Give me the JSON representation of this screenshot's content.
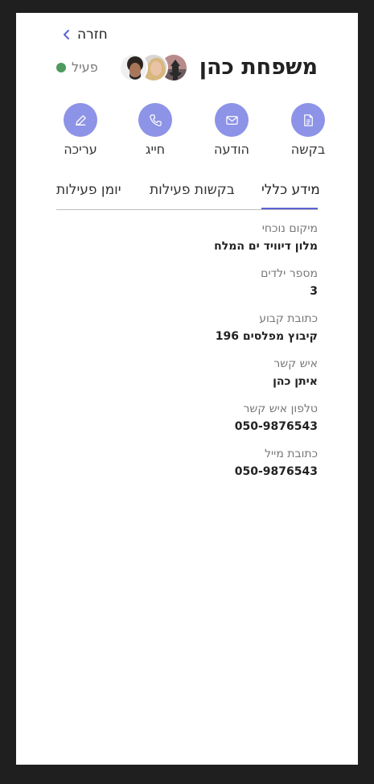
{
  "back": {
    "label": "חזרה"
  },
  "header": {
    "title": "משפחת כהן",
    "status": {
      "text": "פעיל",
      "color": "#4f9a5f"
    },
    "avatars": [
      "man-curly-hair",
      "woman-blonde",
      "pagoda-sunset"
    ]
  },
  "actions": [
    {
      "label": "בקשה",
      "icon": "document-icon"
    },
    {
      "label": "הודעה",
      "icon": "mail-icon"
    },
    {
      "label": "חייג",
      "icon": "phone-icon"
    },
    {
      "label": "עריכה",
      "icon": "pencil-icon"
    }
  ],
  "tabs": [
    {
      "label": "מידע כללי",
      "active": true
    },
    {
      "label": "בקשות פעילות",
      "active": false
    },
    {
      "label": "יומן פעילות",
      "active": false
    }
  ],
  "info": [
    {
      "key": "מיקום נוכחי",
      "value": "מלון דיוויד ים המלח"
    },
    {
      "key": "מספר ילדים",
      "value": "3"
    },
    {
      "key": "כתובת קבוע",
      "value": "קיבוץ מפלסים 196"
    },
    {
      "key": "איש קשר",
      "value": "איתן כהן"
    },
    {
      "key": "טלפון איש קשר",
      "value": "050-9876543"
    },
    {
      "key": "כתובת מייל",
      "value": "050-9876543"
    }
  ],
  "colors": {
    "accent": "#8d93e6",
    "tab_underline": "#5b62d6",
    "status": "#4f9a5f"
  }
}
